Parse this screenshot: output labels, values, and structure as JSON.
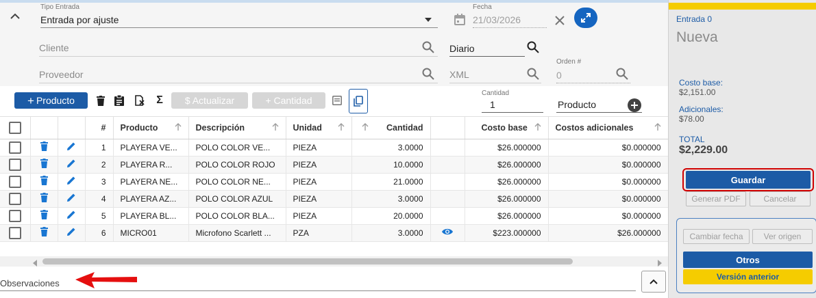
{
  "form": {
    "tipo_entrada": {
      "label": "Tipo Entrada",
      "value": "Entrada por ajuste"
    },
    "fecha": {
      "label": "Fecha",
      "value": "21/03/2026"
    },
    "cliente": {
      "placeholder": "Cliente"
    },
    "diario": {
      "value": "Diario"
    },
    "proveedor": {
      "placeholder": "Proveedor"
    },
    "xml": {
      "placeholder": "XML"
    },
    "orden": {
      "label": "Orden #",
      "value": "0"
    }
  },
  "toolbar": {
    "producto_label": "Producto",
    "actualizar_label": "$ Actualizar",
    "cantidad_label": "+ Cantidad",
    "cantidad_field_label": "Cantidad",
    "cantidad_field_value": "1",
    "producto_field_value": "Producto"
  },
  "table": {
    "columns": [
      "#",
      "Producto",
      "Descripción",
      "Unidad",
      "Cantidad",
      "Costo base",
      "Costos adicionales"
    ],
    "rows": [
      {
        "n": "1",
        "producto": "PLAYERA VE...",
        "descripcion": "POLO COLOR VE...",
        "unidad": "PIEZA",
        "cantidad": "3.0000",
        "costo_base": "$26.000000",
        "adicionales": "$0.000000",
        "view": false
      },
      {
        "n": "2",
        "producto": "PLAYERA R...",
        "descripcion": "POLO COLOR ROJO",
        "unidad": "PIEZA",
        "cantidad": "10.0000",
        "costo_base": "$26.000000",
        "adicionales": "$0.000000",
        "view": false
      },
      {
        "n": "3",
        "producto": "PLAYERA NE...",
        "descripcion": "POLO COLOR NE...",
        "unidad": "PIEZA",
        "cantidad": "21.0000",
        "costo_base": "$26.000000",
        "adicionales": "$0.000000",
        "view": false
      },
      {
        "n": "4",
        "producto": "PLAYERA AZ...",
        "descripcion": "POLO COLOR AZUL",
        "unidad": "PIEZA",
        "cantidad": "3.0000",
        "costo_base": "$26.000000",
        "adicionales": "$0.000000",
        "view": false
      },
      {
        "n": "5",
        "producto": "PLAYERA BL...",
        "descripcion": "POLO COLOR BLA...",
        "unidad": "PIEZA",
        "cantidad": "20.0000",
        "costo_base": "$26.000000",
        "adicionales": "$0.000000",
        "view": false
      },
      {
        "n": "6",
        "producto": "MICRO01",
        "descripcion": "Microfono Scarlett ...",
        "unidad": "PZA",
        "cantidad": "3.0000",
        "costo_base": "$223.000000",
        "adicionales": "$26.000000",
        "view": true
      }
    ]
  },
  "observaciones": {
    "label": "Observaciones"
  },
  "panel": {
    "entry_title": "Entrada 0",
    "status": "Nueva",
    "costo_base_label": "Costo base:",
    "costo_base_value": "$2,151.00",
    "adicionales_label": "Adicionales:",
    "adicionales_value": "$78.00",
    "total_label": "TOTAL",
    "total_value": "$2,229.00",
    "guardar": "Guardar",
    "generar_pdf": "Generar PDF",
    "cancelar": "Cancelar",
    "cambiar_fecha": "Cambiar fecha",
    "ver_origen": "Ver origen",
    "otros": "Otros",
    "version_anterior": "Versión anterior"
  },
  "colors": {
    "primary": "#1c5ba6",
    "accent_yellow": "#f5cc00",
    "highlight_red": "#d00000",
    "icon_blue": "#1976d2"
  }
}
